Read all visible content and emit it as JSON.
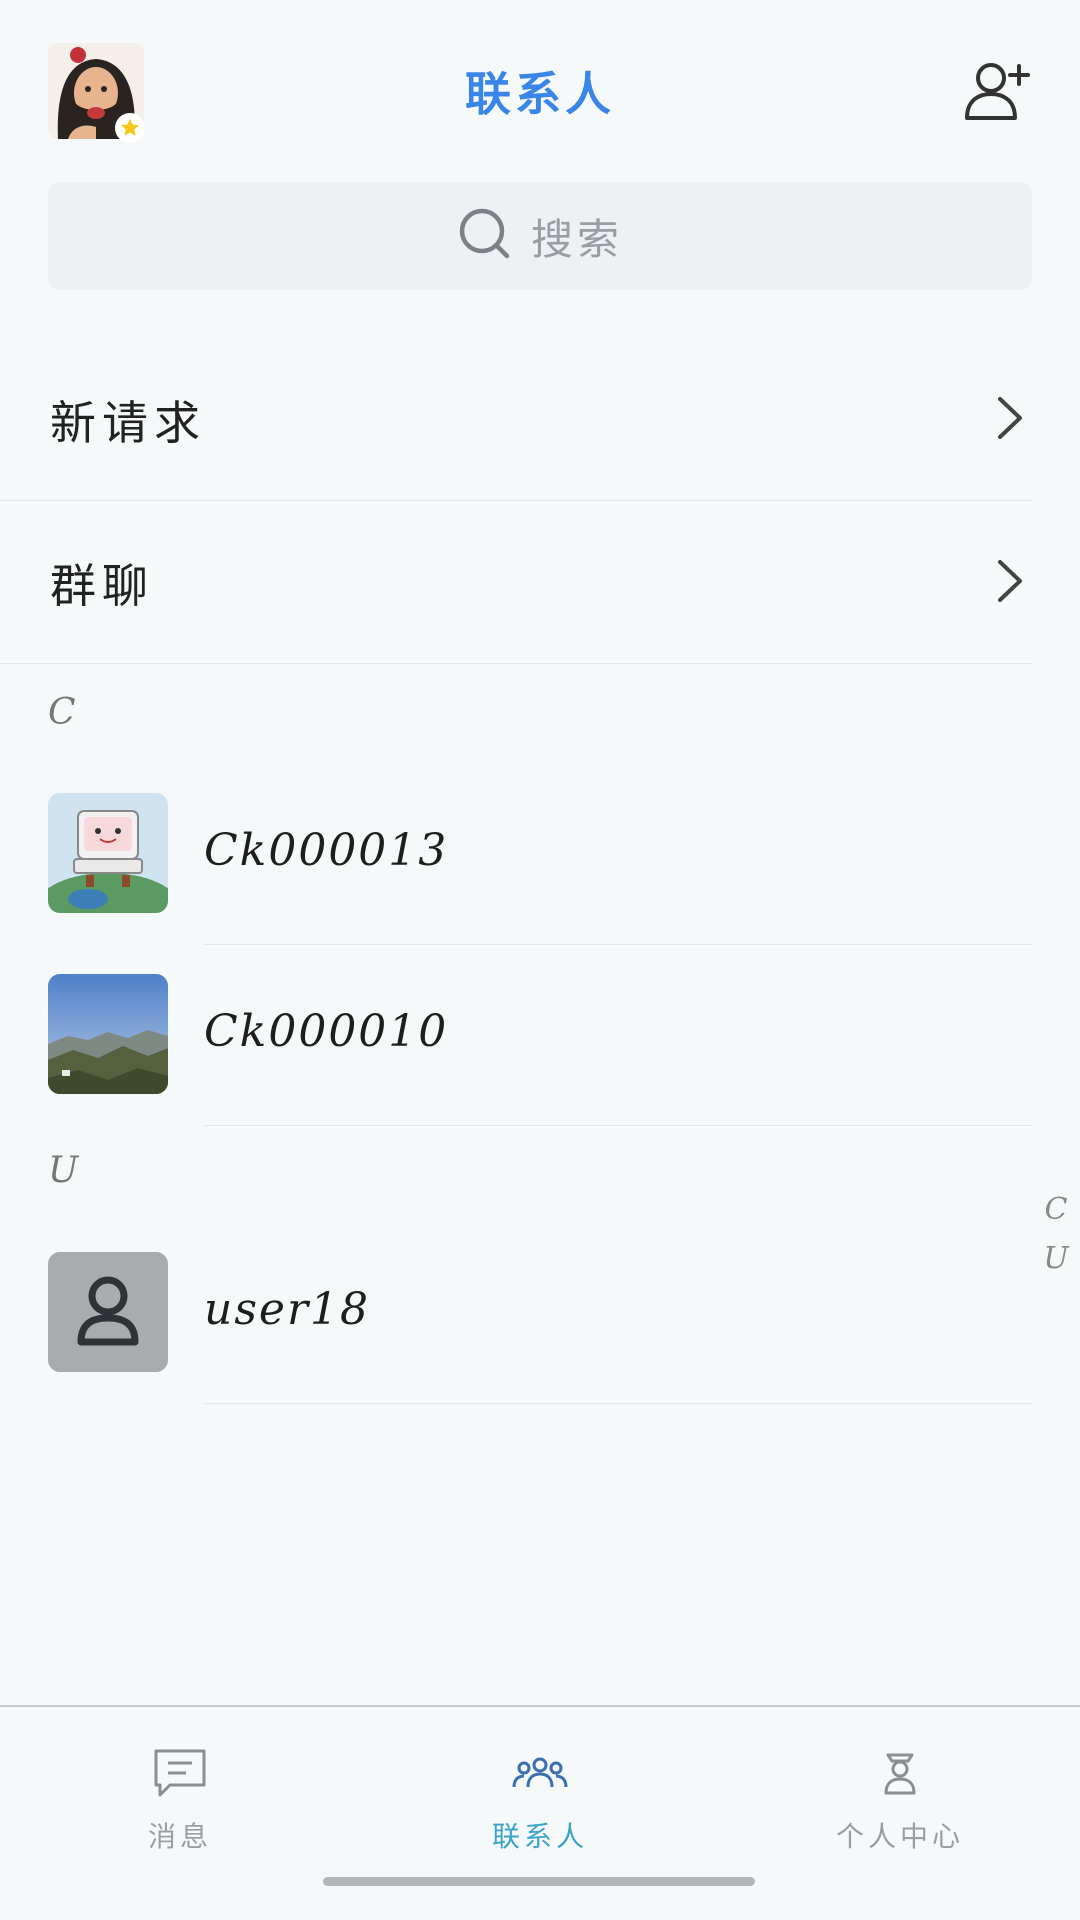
{
  "header": {
    "title": "联系人",
    "avatar_icon": "user-avatar",
    "badge_icon": "star-icon",
    "add_icon": "add-person-icon"
  },
  "search": {
    "placeholder": "搜索",
    "icon": "search-icon"
  },
  "menu": [
    {
      "label": "新请求",
      "icon": "chevron-right-icon"
    },
    {
      "label": "群聊",
      "icon": "chevron-right-icon"
    }
  ],
  "sections": [
    {
      "letter": "C",
      "contacts": [
        {
          "name": "Ck000013"
        },
        {
          "name": "Ck000010"
        }
      ]
    },
    {
      "letter": "U",
      "contacts": [
        {
          "name": "user18"
        }
      ]
    }
  ],
  "index_bar": [
    "C",
    "U"
  ],
  "tabbar": {
    "tabs": [
      {
        "label": "消息",
        "icon": "message-icon",
        "active": false
      },
      {
        "label": "联系人",
        "icon": "contacts-icon",
        "active": true
      },
      {
        "label": "个人中心",
        "icon": "profile-icon",
        "active": false
      }
    ],
    "active_color": "#3aa3c8",
    "inactive_color": "#9a9ea4"
  },
  "colors": {
    "accent": "#3a86e8",
    "background": "#f6f9fa"
  }
}
